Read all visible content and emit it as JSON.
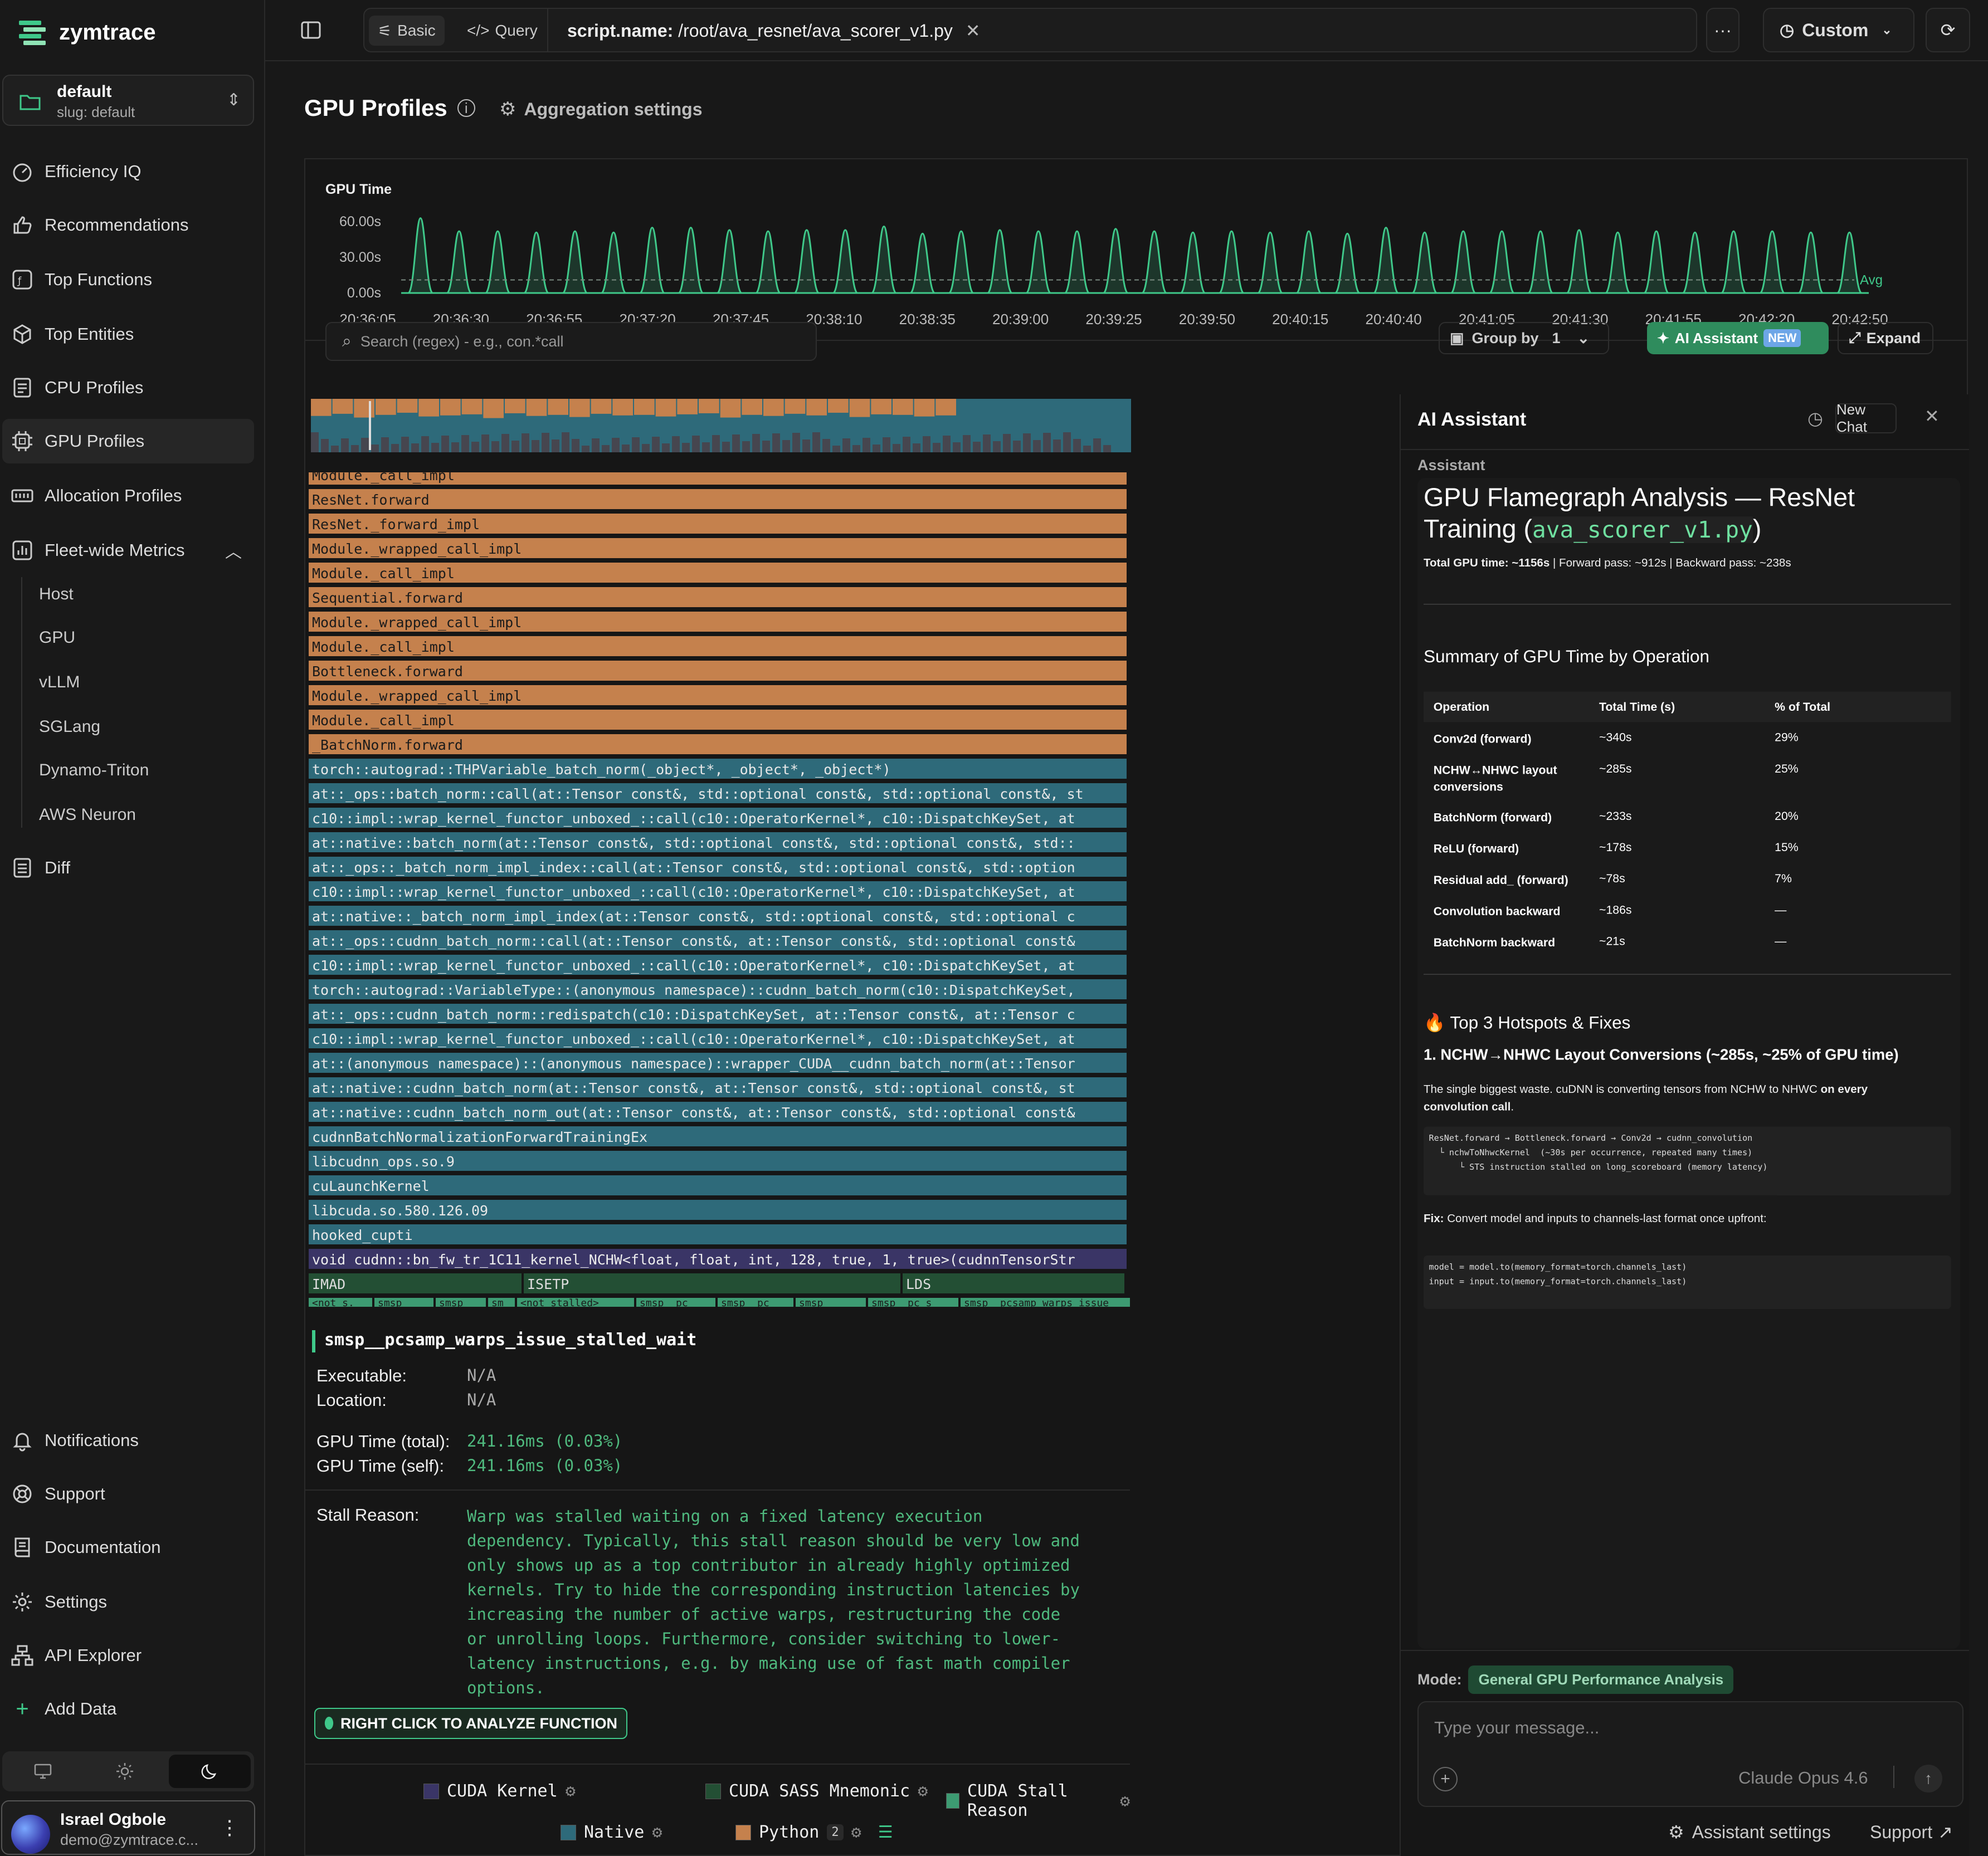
{
  "app": {
    "name": "zymtrace"
  },
  "project": {
    "name": "default",
    "slug": "slug: default"
  },
  "nav": {
    "items": [
      "Efficiency IQ",
      "Recommendations",
      "Top Functions",
      "Top Entities",
      "CPU Profiles",
      "GPU Profiles",
      "Allocation Profiles",
      "Fleet-wide Metrics"
    ],
    "sub": [
      "Host",
      "GPU",
      "vLLM",
      "SGLang",
      "Dynamo-Triton",
      "AWS Neuron"
    ],
    "diff": "Diff",
    "bottom": [
      "Notifications",
      "Support",
      "Documentation",
      "Settings",
      "API Explorer",
      "Add Data"
    ]
  },
  "user": {
    "name": "Israel Ogbole",
    "email": "demo@zymtrace.c..."
  },
  "topbar": {
    "basic": "Basic",
    "query": "Query",
    "filter_key": "script.name:",
    "filter_value": "/root/ava_resnet/ava_scorer_v1.py",
    "time_range": "Custom"
  },
  "page": {
    "title": "GPU Profiles",
    "aggregation": "Aggregation settings"
  },
  "chart_data": {
    "type": "area",
    "title": "GPU Time",
    "y_ticks": [
      "60.00s",
      "30.00s",
      "0.00s"
    ],
    "ylim": [
      0,
      60
    ],
    "x_ticks": [
      "20:36:05",
      "20:36:30",
      "20:36:55",
      "20:37:20",
      "20:37:45",
      "20:38:10",
      "20:38:35",
      "20:39:00",
      "20:39:25",
      "20:39:50",
      "20:40:15",
      "20:40:40",
      "20:41:05",
      "20:41:30",
      "20:41:55",
      "20:42:20",
      "20:42:50"
    ],
    "peaks": [
      63,
      52,
      52,
      51,
      52,
      51,
      55,
      55,
      53,
      52,
      53,
      53,
      56,
      50,
      52,
      53,
      52,
      52,
      54,
      52,
      51,
      52,
      51,
      52,
      50,
      55,
      51,
      52,
      52,
      52,
      53,
      51,
      52,
      51,
      52,
      52,
      51,
      51,
      51,
      52,
      52,
      51,
      51,
      52,
      53,
      51,
      52,
      51,
      49,
      52,
      51,
      52,
      52,
      52,
      52,
      52,
      50,
      51,
      51,
      52,
      51,
      50,
      52,
      55,
      52,
      51,
      51,
      52,
      52,
      51,
      50,
      51,
      52,
      52,
      51,
      53,
      52,
      52,
      55,
      52,
      51,
      53,
      54,
      52,
      53
    ],
    "peak_times_note": "",
    "avg_label": "Avg",
    "avg": 11
  },
  "toolbar": {
    "search_placeholder": "Search (regex) - e.g., con.*call",
    "group_by": "Group by",
    "group_count": "1",
    "ai_button": "AI Assistant",
    "new_badge": "NEW",
    "expand": "Expand"
  },
  "flame": {
    "python_rows": [
      "Module._call_impl",
      "ResNet.forward",
      "ResNet._forward_impl",
      "Module._wrapped_call_impl",
      "Module._call_impl",
      "Sequential.forward",
      "Module._wrapped_call_impl",
      "Module._call_impl",
      "Bottleneck.forward",
      "Module._wrapped_call_impl",
      "Module._call_impl",
      "_BatchNorm.forward"
    ],
    "native_rows": [
      "torch::autograd::THPVariable_batch_norm(_object*, _object*, _object*)",
      "at::_ops::batch_norm::call(at::Tensor const&, std::optional const&, std::optional const&, st",
      "c10::impl::wrap_kernel_functor_unboxed_::call(c10::OperatorKernel*, c10::DispatchKeySet, at",
      "at::native::batch_norm(at::Tensor const&, std::optional const&, std::optional const&, std::",
      "at::_ops::_batch_norm_impl_index::call(at::Tensor const&, std::optional const&, std::option",
      "c10::impl::wrap_kernel_functor_unboxed_::call(c10::OperatorKernel*, c10::DispatchKeySet, at",
      "at::native::_batch_norm_impl_index(at::Tensor const&, std::optional const&, std::optional c",
      "at::_ops::cudnn_batch_norm::call(at::Tensor const&, at::Tensor const&, std::optional const&",
      "c10::impl::wrap_kernel_functor_unboxed_::call(c10::OperatorKernel*, c10::DispatchKeySet, at",
      "torch::autograd::VariableType::(anonymous namespace)::cudnn_batch_norm(c10::DispatchKeySet,",
      "at::_ops::cudnn_batch_norm::redispatch(c10::DispatchKeySet, at::Tensor const&, at::Tensor c",
      "c10::impl::wrap_kernel_functor_unboxed_::call(c10::OperatorKernel*, c10::DispatchKeySet, at",
      "at::(anonymous namespace)::(anonymous namespace)::wrapper_CUDA__cudnn_batch_norm(at::Tensor",
      "at::native::cudnn_batch_norm(at::Tensor const&, at::Tensor const&, std::optional const&, st",
      "at::native::cudnn_batch_norm_out(at::Tensor const&, at::Tensor const&, std::optional const&",
      "cudnnBatchNormalizationForwardTrainingEx",
      "libcudnn_ops.so.9",
      "cuLaunchKernel",
      "libcuda.so.580.126.09",
      "hooked_cupti"
    ],
    "kernel_row": "void cudnn::bn_fw_tr_1C11_kernel_NCHW<float, float, int, 128, true, 1, true>(cudnnTensorStr",
    "sass_row": [
      "IMAD",
      "ISETP",
      "LDS"
    ],
    "stall_row": [
      "<not_s.",
      "smsp_",
      "smsp_",
      "sm",
      "<not_stalled>",
      "smsp__pc",
      "smsp__pc",
      "smsp_",
      "smsp__pc_s",
      "smsp__pcsamp_warps_issue"
    ]
  },
  "detail": {
    "title": "smsp__pcsamp_warps_issue_stalled_wait",
    "executable_label": "Executable:",
    "executable": "N/A",
    "location_label": "Location:",
    "location": "N/A",
    "gpu_total_label": "GPU Time (total):",
    "gpu_total": "241.16ms (0.03%)",
    "gpu_self_label": "GPU Time (self):",
    "gpu_self": "241.16ms (0.03%)",
    "stall_label": "Stall Reason:",
    "stall_lines": [
      "Warp was stalled waiting on a fixed latency execution",
      "dependency. Typically, this stall reason should be very low and",
      "only shows up as a top contributor in already highly optimized",
      "kernels. Try to hide the corresponding instruction latencies by",
      "increasing the number of active warps, restructuring the code",
      "or unrolling loops. Furthermore, consider switching to lower-",
      "latency instructions, e.g. by making use of fast math compiler",
      "options."
    ],
    "right_click": "RIGHT CLICK TO ANALYZE FUNCTION"
  },
  "legend": {
    "items": [
      "CUDA Kernel",
      "CUDA SASS Mnemonic",
      "CUDA Stall Reason",
      "Native",
      "Python"
    ],
    "python_count": "2",
    "colors": {
      "kernel": "#3a3566",
      "sass": "#234f34",
      "stall": "#3d9b72",
      "native": "#2e6a7a",
      "python": "#c5814d"
    }
  },
  "ai": {
    "title": "AI Assistant",
    "new_chat": "New Chat",
    "role": "Assistant",
    "heading_a": "GPU Flamegraph Analysis — ResNet",
    "heading_b": "Training (",
    "heading_code": "ava_scorer_v1.py",
    "heading_c": ")",
    "totals_bold": "Total GPU time: ~1156s",
    "totals_rest": " | Forward pass: ~912s | Backward pass: ~238s",
    "summary_title": "Summary of GPU Time by Operation",
    "table_headers": [
      "Operation",
      "Total Time (s)",
      "% of Total"
    ],
    "table_rows": [
      [
        "Conv2d (forward)",
        "~340s",
        "29%"
      ],
      [
        "NCHW↔NHWC layout conversions",
        "~285s",
        "25%"
      ],
      [
        "BatchNorm (forward)",
        "~233s",
        "20%"
      ],
      [
        "ReLU (forward)",
        "~178s",
        "15%"
      ],
      [
        "Residual add_ (forward)",
        "~78s",
        "7%"
      ],
      [
        "Convolution backward",
        "~186s",
        "—"
      ],
      [
        "BatchNorm backward",
        "~21s",
        "—"
      ]
    ],
    "hotspots_title": "🔥 Top 3 Hotspots & Fixes",
    "hotspot1_title": "1. NCHW→NHWC Layout Conversions (~285s, ~25% of GPU time)",
    "hotspot1_text_a": "The single biggest waste. cuDNN is converting tensors from NCHW to NHWC ",
    "hotspot1_text_b": "on every",
    "hotspot1_text_c": "convolution call",
    "hotspot1_text_d": ".",
    "code1": [
      "ResNet.forward → Bottleneck.forward → Conv2d → cudnn_convolution",
      "  └ nchwToNhwcKernel  (~30s per occurrence, repeated many times)",
      "      └ STS instruction stalled on long_scoreboard (memory latency)"
    ],
    "fix_bold": "Fix:",
    "fix_text": " Convert model and inputs to channels-last format once upfront:",
    "code2": [
      "model = model.to(memory_format=torch.channels_last)",
      "input = input.to(memory_format=torch.channels_last)"
    ],
    "mode_label": "Mode:",
    "mode_value": "General GPU Performance Analysis",
    "message_placeholder": "Type your message...",
    "model": "Claude Opus 4.6",
    "assistant_settings": "Assistant settings",
    "support": "Support"
  }
}
